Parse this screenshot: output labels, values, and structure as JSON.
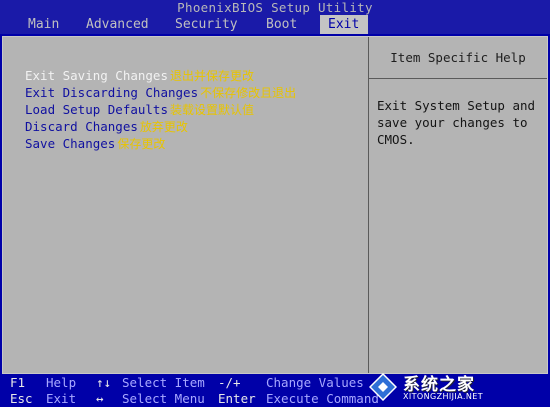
{
  "title": "PhoenixBIOS Setup Utility",
  "menu": [
    {
      "label": "Main"
    },
    {
      "label": "Advanced"
    },
    {
      "label": "Security"
    },
    {
      "label": "Boot"
    },
    {
      "label": "Exit",
      "active": true
    }
  ],
  "options": [
    {
      "label": "Exit Saving Changes",
      "note": "退出并保存更改",
      "selected": true
    },
    {
      "label": "Exit Discarding Changes",
      "note": "不保存修改且退出"
    },
    {
      "label": "Load Setup Defaults",
      "note": "装载设置默认值"
    },
    {
      "label": "Discard Changes",
      "note": "放弃更改"
    },
    {
      "label": "Save Changes",
      "note": "保存更改"
    }
  ],
  "help": {
    "header": "Item Specific Help",
    "text": "Exit System Setup and\nsave your changes to\nCMOS."
  },
  "footer": {
    "row1": [
      {
        "key": "F1",
        "desc": "Help"
      },
      {
        "key": "↑↓",
        "desc": "Select Item"
      },
      {
        "key": "-/+",
        "desc": "Change Values"
      }
    ],
    "row2": [
      {
        "key": "Esc",
        "desc": "Exit"
      },
      {
        "key": "↔",
        "desc": "Select Menu"
      },
      {
        "key": "Enter",
        "desc": "Execute Command"
      }
    ]
  },
  "watermark": {
    "title": "系统之家",
    "url": "XITONGZHIJIA.NET"
  },
  "colors": {
    "background": "#0000a8",
    "panel": "#b4b4b4",
    "active_tab": "#c4c4c4",
    "option_text": "#1010a0",
    "selected_option": "#f2f2f2",
    "annotation": "#e8c400"
  }
}
